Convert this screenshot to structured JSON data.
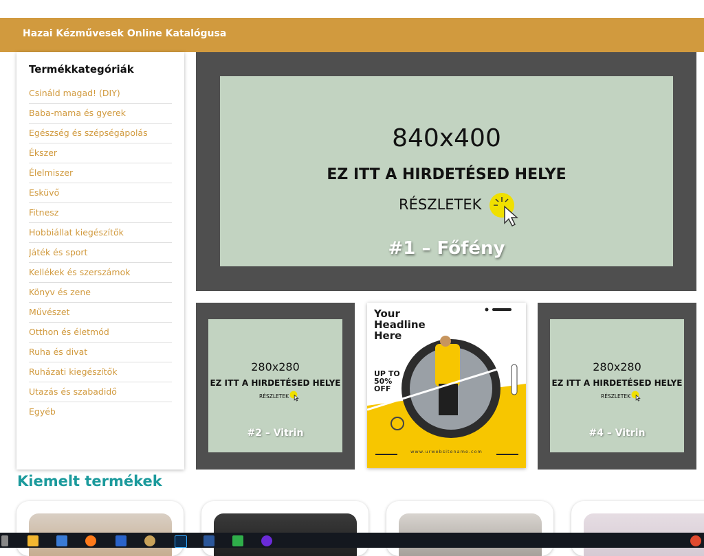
{
  "header": {
    "title": "Hazai Kézművesek Online Katalógusa"
  },
  "sidebar": {
    "title": "Termékkategóriák",
    "categories": [
      "Csináld magad! (DIY)",
      "Baba-mama és gyerek",
      "Egészség és szépségápolás",
      "Ékszer",
      "Élelmiszer",
      "Esküvő",
      "Fitnesz",
      "Hobbiállat kiegészítők",
      "Játék és sport",
      "Kellékek és szerszámok",
      "Könyv és zene",
      "Művészet",
      "Otthon és életmód",
      "Ruha és divat",
      "Ruházati kiegészítők",
      "Utazás és szabadidő",
      "Egyéb"
    ]
  },
  "banners": {
    "main": {
      "size": "840x400",
      "headline": "EZ ITT A HIRDETÉSED HELYE",
      "details": "RÉSZLETEK",
      "label": "#1 – Főfény"
    },
    "slot2": {
      "size": "280x280",
      "headline": "EZ ITT A HIRDETÉSED HELYE",
      "details": "RÉSZLETEK",
      "label": "#2 – Vitrin"
    },
    "promo": {
      "headline": "Your\nHeadline\nHere",
      "badge": "UP TO\n50%\nOFF",
      "url": "www.urwebsitename.com"
    },
    "slot4": {
      "size": "280x280",
      "headline": "EZ ITT A HIRDETÉSED HELYE",
      "details": "RÉSZLETEK",
      "label": "#4 – Vitrin"
    }
  },
  "featured": {
    "title": "Kiemelt termékek"
  },
  "colors": {
    "accent": "#d19a3e",
    "teal": "#1b9a9c",
    "banner_bg": "#4f4f4f",
    "placeholder": "#c2d3c1",
    "promo_yellow": "#f7c600"
  }
}
